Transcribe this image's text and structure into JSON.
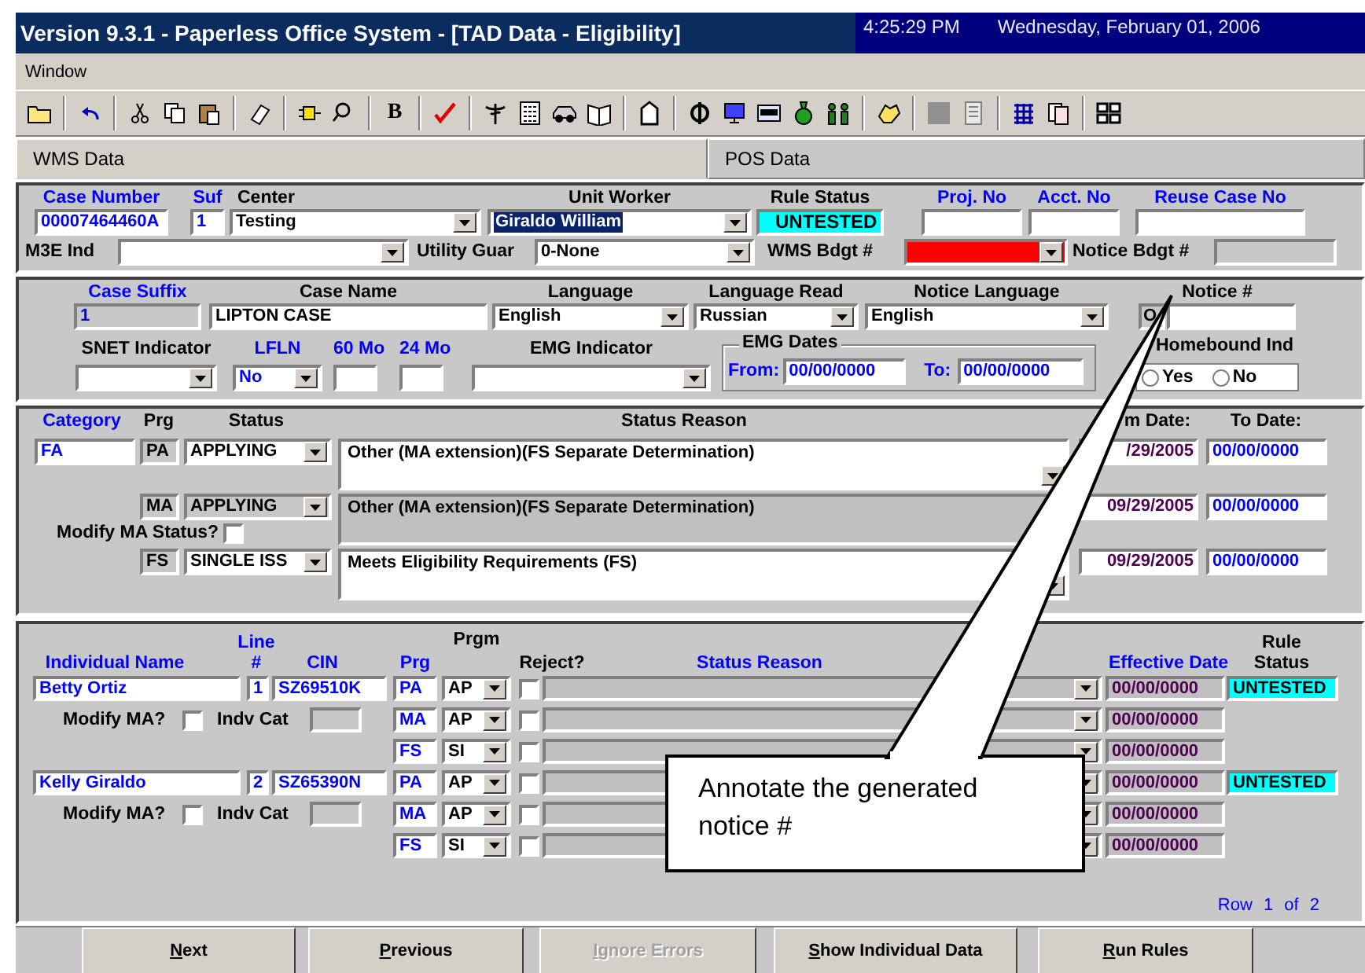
{
  "window": {
    "title": "Version 9.3.1 - Paperless Office System - [TAD Data - Eligibility]",
    "time": "4:25:29 PM",
    "date": "Wednesday, February 01, 2006"
  },
  "menu": [
    {
      "label": "Window"
    }
  ],
  "toolbar": {
    "bold_button": "B"
  },
  "tabs": [
    {
      "label": "WMS Data",
      "selected": true
    },
    {
      "label": "POS Data",
      "selected": false
    }
  ],
  "case_header": {
    "row1": [
      {
        "label": "Case Number",
        "color": "#0000ff",
        "kind": "text",
        "value": "00007464460A"
      },
      {
        "label": "Suf",
        "color": "#0000ff",
        "kind": "text",
        "value": "1"
      },
      {
        "label": "Center",
        "color": "#000000",
        "kind": "combo",
        "value": "Testing"
      },
      {
        "label": "Unit Worker",
        "color": "#000000",
        "kind": "combo",
        "value": "Giraldo William",
        "highlighted": true
      },
      {
        "label": "Rule Status",
        "color": "#000000",
        "kind": "status",
        "value": "UNTESTED"
      },
      {
        "label": "Proj. No",
        "color": "#0000ff",
        "kind": "text"
      },
      {
        "label": "Acct. No",
        "color": "#0000ff",
        "kind": "text"
      },
      {
        "label": "Reuse Case No",
        "color": "#0000ff",
        "kind": "text"
      }
    ],
    "row2": [
      {
        "label": "M3E Ind",
        "kind": "combo"
      },
      {
        "label": "Utility Guar",
        "kind": "combo",
        "value": "0-None"
      },
      {
        "label": "WMS Bdgt #",
        "kind": "combo",
        "color": "#ff0000"
      },
      {
        "label": "Notice Bdgt #",
        "kind": "readonly"
      }
    ]
  },
  "case_details": {
    "row1": [
      {
        "label": "Case Suffix",
        "color": "#0000ff",
        "kind": "readonly",
        "value": "1"
      },
      {
        "label": "Case Name",
        "color": "#000000",
        "kind": "text",
        "value": "LIPTON CASE"
      },
      {
        "label": "Language",
        "color": "#000000",
        "kind": "combo",
        "value": "English"
      },
      {
        "label": "Language Read",
        "color": "#000000",
        "kind": "combo",
        "value": "Russian"
      },
      {
        "label": "Notice Language",
        "color": "#000000",
        "kind": "combo",
        "value": "English"
      },
      {
        "label": "Notice #",
        "color": "#000000",
        "kind": "notice",
        "prefix": "O"
      }
    ],
    "row2": [
      {
        "label": "SNET Indicator",
        "color": "#000000",
        "kind": "combo"
      },
      {
        "label": "LFLN",
        "color": "#0000ff",
        "kind": "combo",
        "value": "No"
      },
      {
        "label": "60 Mo",
        "color": "#0000ff",
        "kind": "text"
      },
      {
        "label": "24 Mo",
        "color": "#0000ff",
        "kind": "text"
      },
      {
        "label": "EMG Indicator",
        "color": "#000000",
        "kind": "combo"
      }
    ],
    "emg_dates": {
      "label": "EMG Dates",
      "from_label": "From:",
      "from": "00/00/0000",
      "to_label": "To:",
      "to": "00/00/0000"
    },
    "homebound": {
      "label": "Homebound Ind",
      "options": [
        {
          "label": "Yes",
          "selected": false
        },
        {
          "label": "No",
          "selected": false
        }
      ]
    }
  },
  "programs": {
    "columns": [
      {
        "label": "Category",
        "color": "#0000ff"
      },
      {
        "label": "Prg",
        "color": "#000000"
      },
      {
        "label": "Status",
        "color": "#000000"
      },
      {
        "label": "Status Reason",
        "color": "#000000"
      },
      {
        "label": "m Date:",
        "color": "#000000"
      },
      {
        "label": "To Date:",
        "color": "#000000"
      }
    ],
    "category": "FA",
    "rows": [
      {
        "prg": "PA",
        "status": "APPLYING",
        "reason": "Other (MA extension)(FS Separate Determination)",
        "editable": true,
        "from": "/29/2005",
        "to": "00/00/0000"
      },
      {
        "prg": "MA",
        "status": "APPLYING",
        "reason": "Other (MA extension)(FS Separate Determination)",
        "editable": false,
        "from": "09/29/2005",
        "to": "00/00/0000"
      },
      {
        "prg": "FS",
        "status": "SINGLE ISS",
        "reason": "Meets Eligibility Requirements (FS)",
        "editable": true,
        "from": "09/29/2005",
        "to": "00/00/0000"
      }
    ],
    "modify_ma": {
      "label": "Modify MA Status?",
      "checked": false
    }
  },
  "individuals": {
    "columns": [
      {
        "label": "Individual Name",
        "color": "#0000ff"
      },
      {
        "label": "Line #",
        "color": "#0000ff"
      },
      {
        "label": "CIN",
        "color": "#0000ff"
      },
      {
        "label": "Prg",
        "color": "#0000ff"
      },
      {
        "label": "Prgm",
        "color": "#000000"
      },
      {
        "label": "Reject?",
        "color": "#000000"
      },
      {
        "label": "Status Reason",
        "color": "#0000ff"
      },
      {
        "label": "Effective Date",
        "color": "#0000ff"
      },
      {
        "label": "Rule Status",
        "color": "#000000"
      }
    ],
    "people": [
      {
        "name": "Betty Ortiz",
        "line": "1",
        "cin": "SZ69510K",
        "rule_status": "UNTESTED",
        "modify_label": "Modify MA?",
        "modify_checked": false,
        "indv_cat_label": "Indv Cat",
        "programs": [
          {
            "prg": "PA",
            "code": "AP",
            "reject": false,
            "effective_date": "00/00/0000"
          },
          {
            "prg": "MA",
            "code": "AP",
            "reject": false,
            "effective_date": "00/00/0000"
          },
          {
            "prg": "FS",
            "code": "SI",
            "reject": false,
            "effective_date": "00/00/0000"
          }
        ]
      },
      {
        "name": "Kelly Giraldo",
        "line": "2",
        "cin": "SZ65390N",
        "rule_status": "UNTESTED",
        "modify_label": "Modify MA?",
        "modify_checked": false,
        "indv_cat_label": "Indv Cat",
        "programs": [
          {
            "prg": "PA",
            "code": "AP",
            "reject": false,
            "effective_date": "00/00/0000"
          },
          {
            "prg": "MA",
            "code": "AP",
            "reject": false,
            "effective_date": "00/00/0000"
          },
          {
            "prg": "FS",
            "code": "SI",
            "reject": false,
            "effective_date": "00/00/0000"
          }
        ]
      }
    ],
    "pager": "Row 1 of 2"
  },
  "buttons": [
    {
      "label": "Next",
      "disabled": false
    },
    {
      "label": "Previous",
      "disabled": false
    },
    {
      "label": "Ignore Errors",
      "disabled": true
    },
    {
      "label": "Show Individual Data",
      "disabled": false
    },
    {
      "label": "Run Rules",
      "disabled": false
    }
  ],
  "callout": {
    "text": "Annotate the generated notice #"
  }
}
